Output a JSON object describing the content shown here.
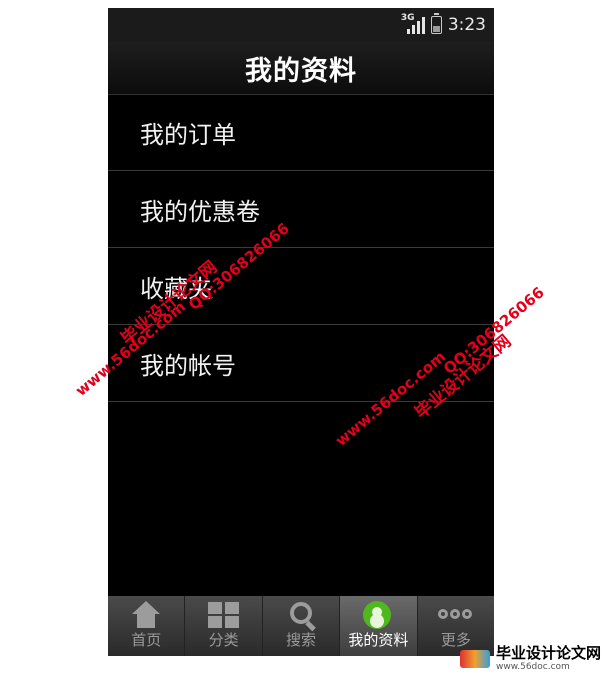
{
  "status_bar": {
    "network": "3G",
    "time": "3:23"
  },
  "header": {
    "title": "我的资料"
  },
  "menu": {
    "items": [
      {
        "label": "我的订单"
      },
      {
        "label": "我的优惠卷"
      },
      {
        "label": "收藏夹"
      },
      {
        "label": "我的帐号"
      }
    ]
  },
  "tabbar": {
    "tabs": [
      {
        "label": "首页",
        "icon": "home-icon"
      },
      {
        "label": "分类",
        "icon": "grid-icon"
      },
      {
        "label": "搜索",
        "icon": "search-icon"
      },
      {
        "label": "我的资料",
        "icon": "profile-icon",
        "active": true
      },
      {
        "label": "更多",
        "icon": "more-icon"
      }
    ]
  },
  "watermark": {
    "site_label": "毕业设计论文网",
    "url": "www.56doc.com",
    "qq": "QQ:306826066"
  },
  "brand": {
    "name": "毕业设计论文网",
    "url": "www.56doc.com"
  },
  "colors": {
    "accent_green": "#4fb81e",
    "watermark_red": "#e4001b"
  }
}
